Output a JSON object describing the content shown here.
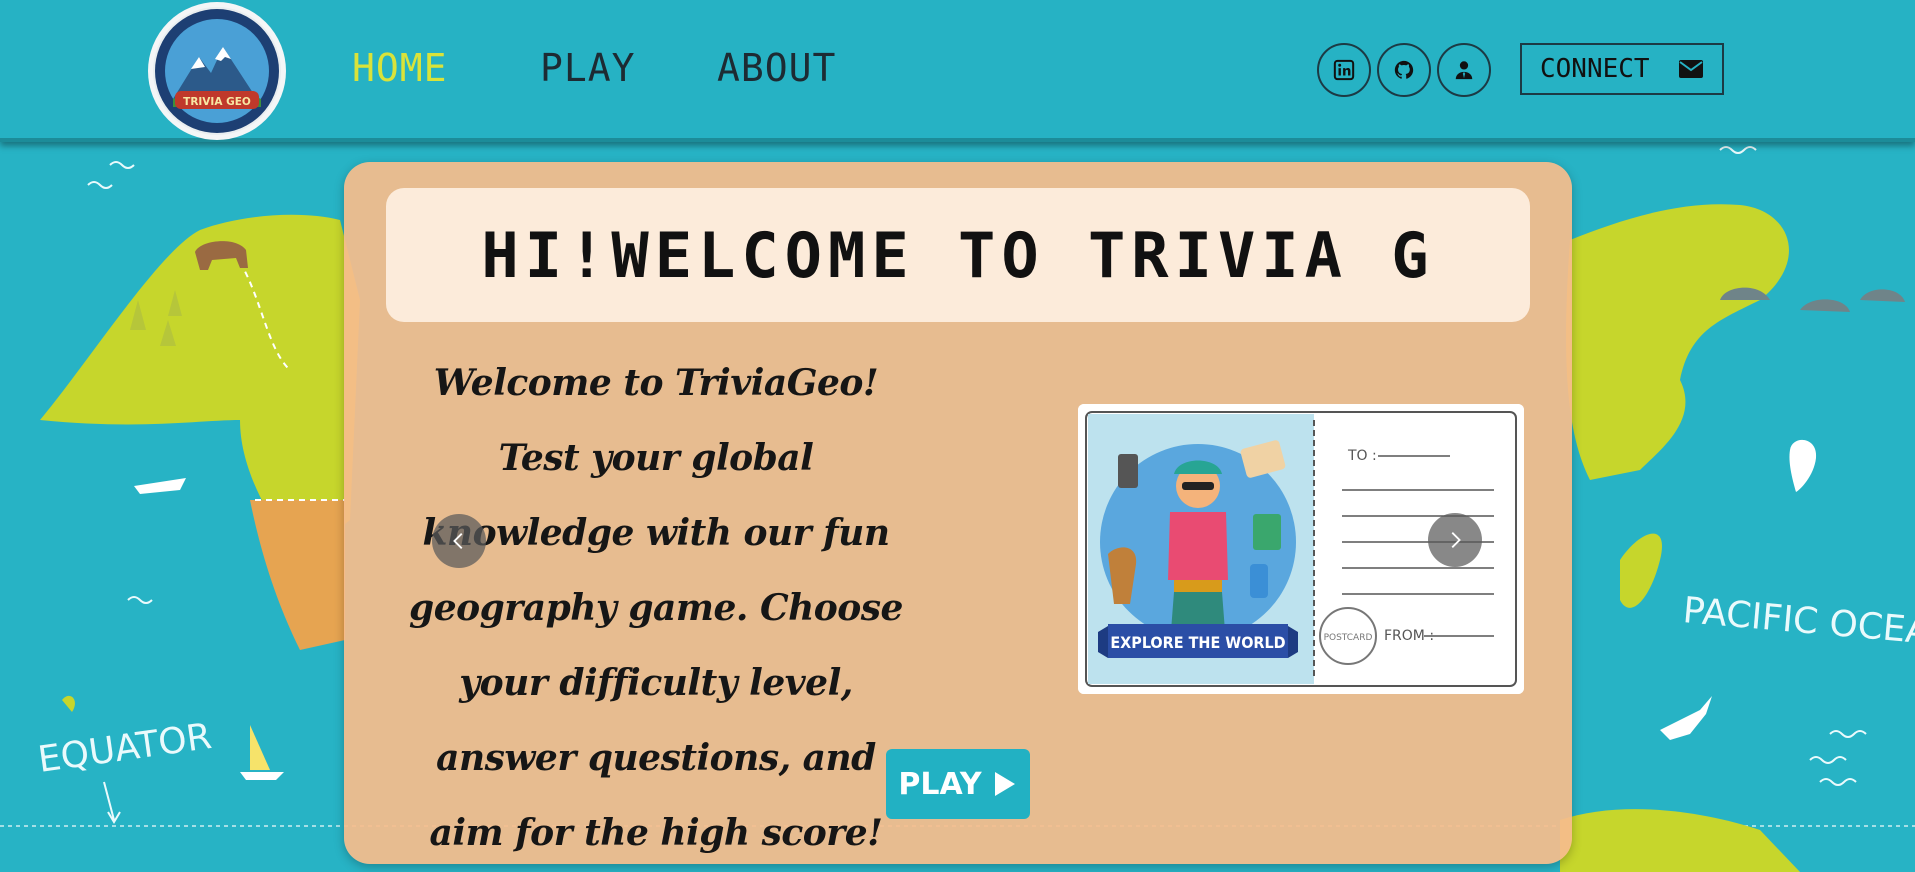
{
  "nav": {
    "logo_text": "TRIVIA GEO",
    "links": [
      {
        "label": "HOME",
        "active": true
      },
      {
        "label": "PLAY",
        "active": false
      },
      {
        "label": "ABOUT",
        "active": false
      }
    ],
    "social_icons": [
      "linkedin-icon",
      "github-icon",
      "person-icon"
    ],
    "connect_label": "CONNECT",
    "connect_icon": "envelope-icon"
  },
  "colors": {
    "background": "#27b3c5",
    "active_nav": "#d9e33a",
    "card": "#f6bc8c",
    "play_button": "#22b1c3",
    "land_green": "#c9d92b",
    "land_orange": "#e8a653"
  },
  "hero": {
    "title": "HI!WELCOME TO TRIVIA G",
    "description": "Welcome to TriviaGeo! Test your global knowledge with our fun geography game. Choose your difficulty level, answer questions, and aim for the high score!",
    "play_label": "PLAY",
    "play_icon": "play-triangle-icon",
    "carousel_prev_icon": "chevron-left-icon",
    "carousel_next_icon": "chevron-right-icon"
  },
  "postcard": {
    "banner_text": "EXPLORE THE WORLD",
    "to_label": "TO :",
    "from_label": "FROM :",
    "stamp_text": "POSTCARD"
  },
  "map_labels": {
    "equator": "EQUATOR",
    "pacific": "PACIFIC OCEAN"
  }
}
